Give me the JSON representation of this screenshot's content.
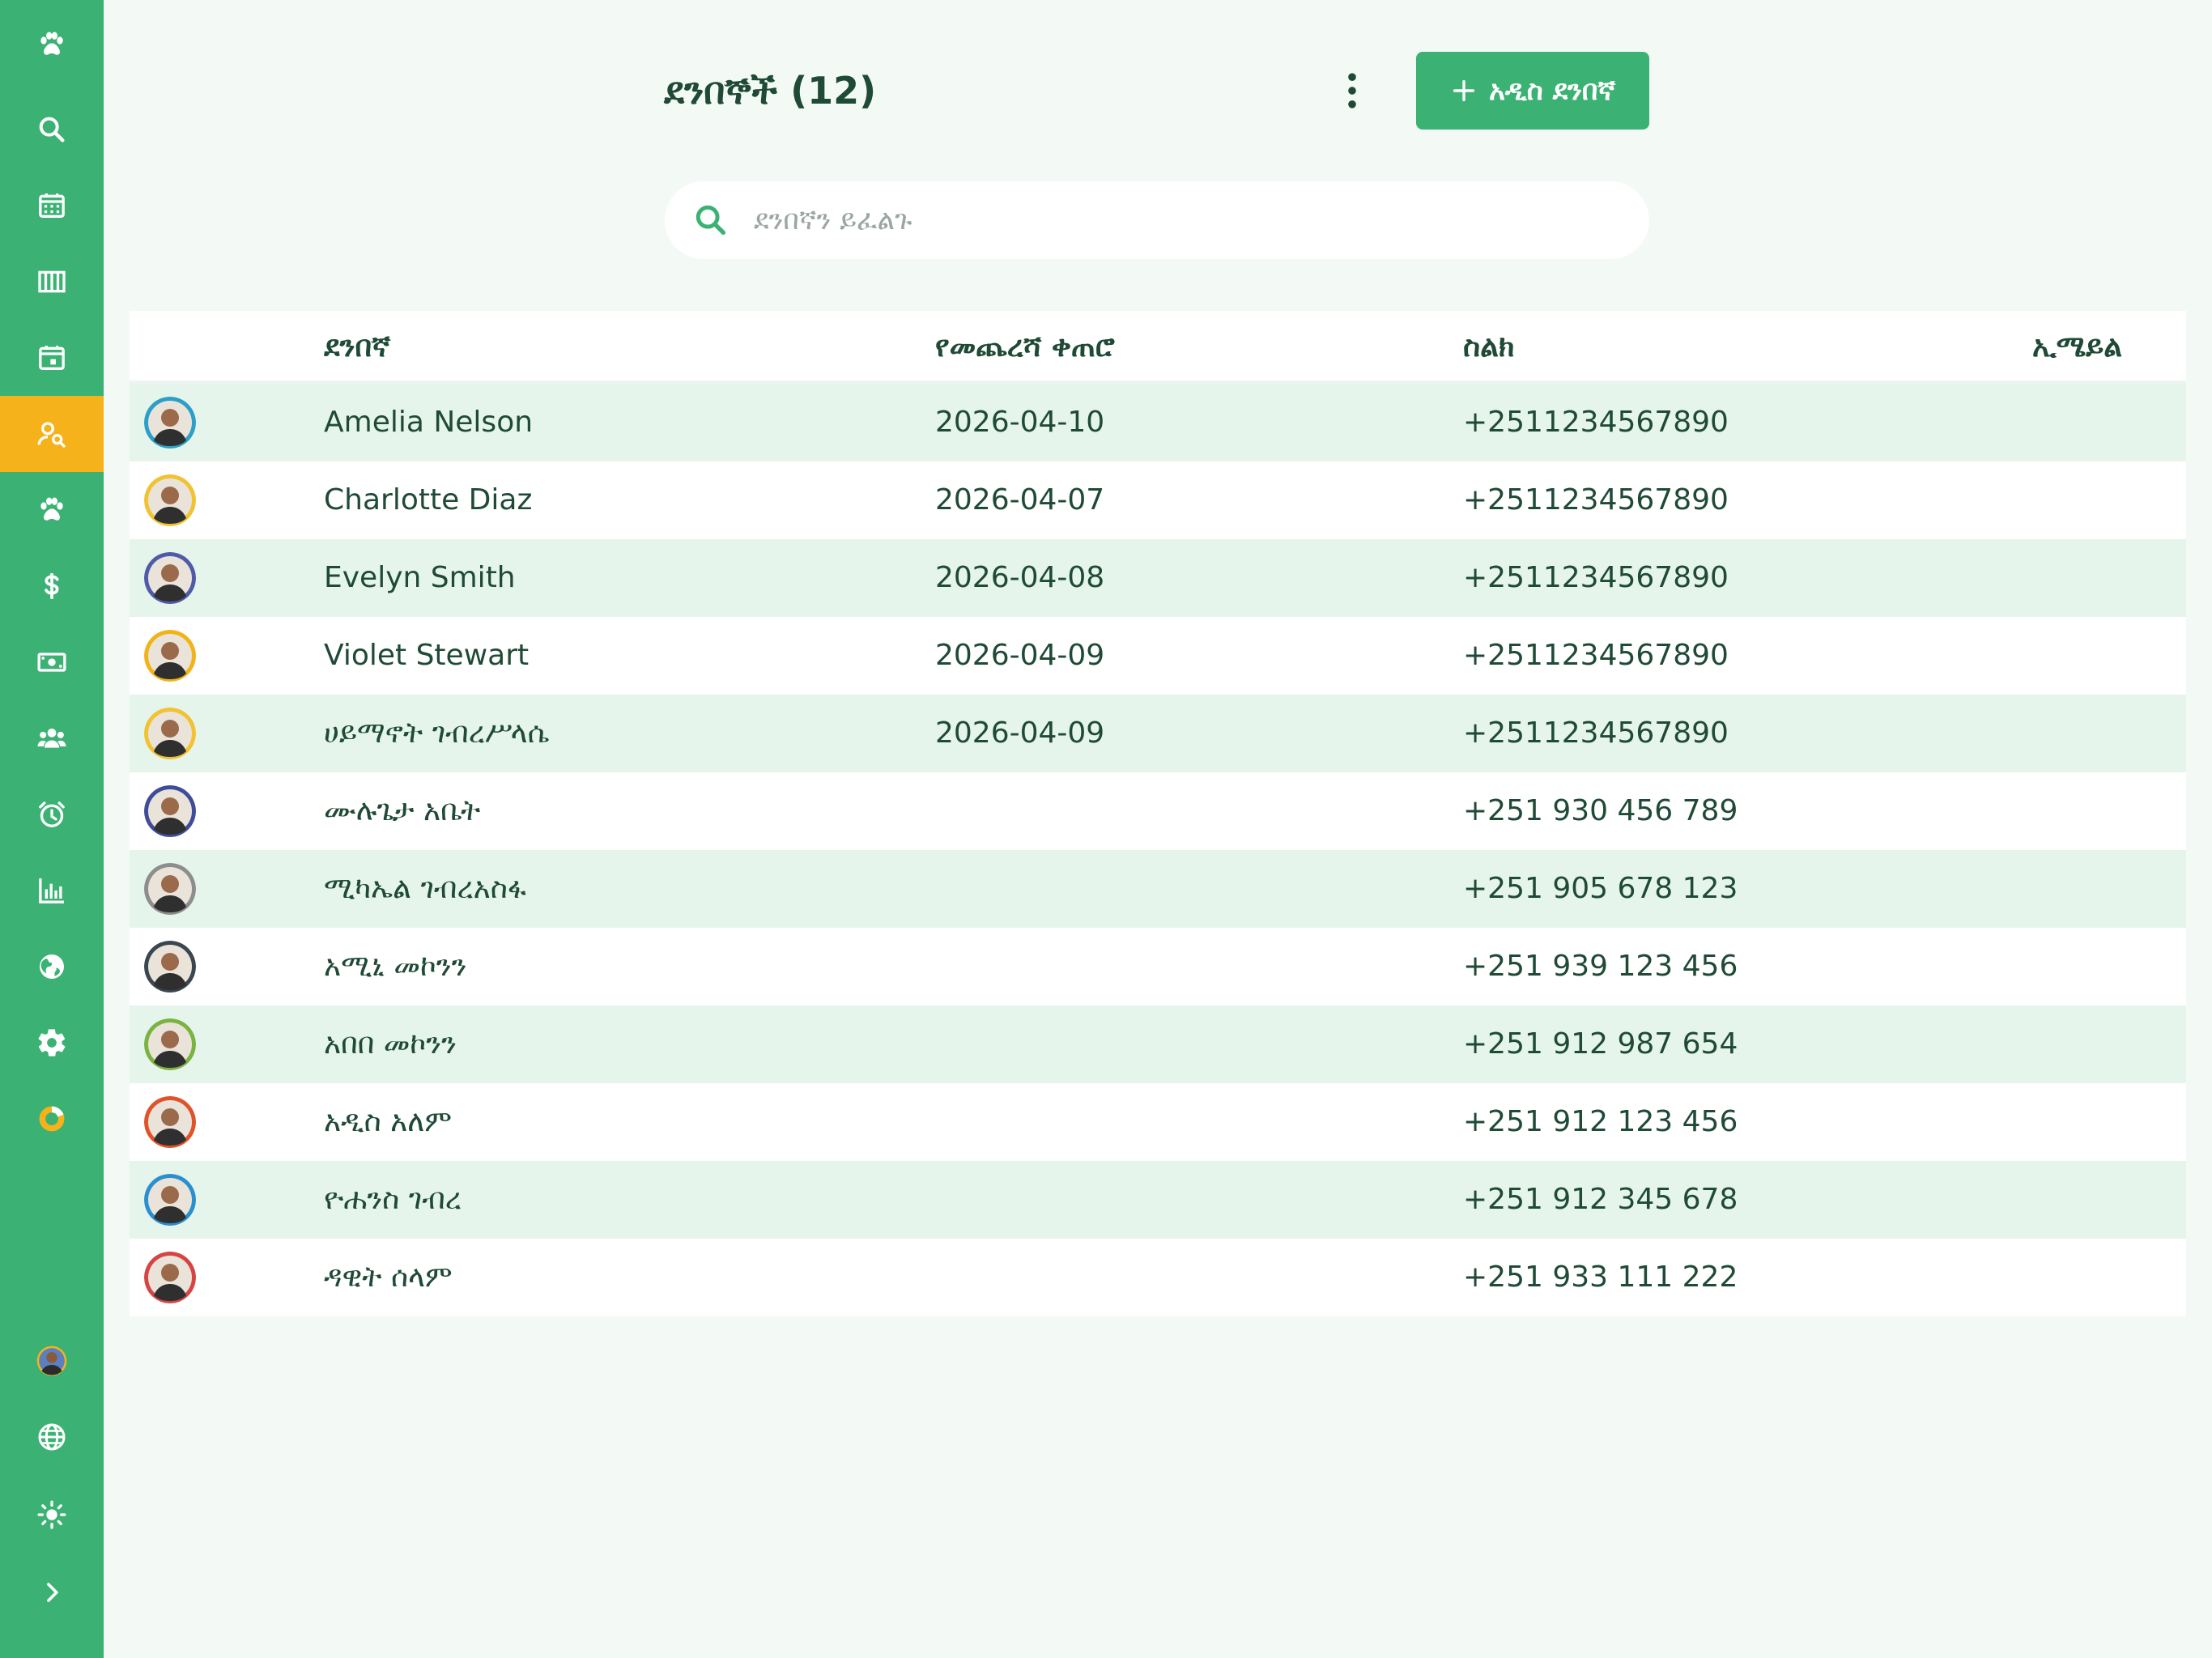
{
  "page": {
    "title": "ደንበኞች (12)",
    "add_button": "አዲስ ደንበኛ",
    "search_placeholder": "ደንበኛን ይፈልጉ"
  },
  "table": {
    "headers": [
      "ደንበኛ",
      "የመጨረሻ ቀጠሮ",
      "ስልክ",
      "ኢሜይል"
    ],
    "rows": [
      {
        "name": "Amelia Nelson",
        "last": "2026-04-10",
        "phone": "+2511234567890",
        "email": "",
        "ring": "#2aa0c8"
      },
      {
        "name": "Charlotte Diaz",
        "last": "2026-04-07",
        "phone": "+2511234567890",
        "email": "",
        "ring": "#f1c232"
      },
      {
        "name": "Evelyn Smith",
        "last": "2026-04-08",
        "phone": "+2511234567890",
        "email": "",
        "ring": "#4f5aa8"
      },
      {
        "name": "Violet Stewart",
        "last": "2026-04-09",
        "phone": "+2511234567890",
        "email": "",
        "ring": "#f1b318"
      },
      {
        "name": "ሀይማኖት ገብረሥላሴ",
        "last": "2026-04-09",
        "phone": "+2511234567890",
        "email": "",
        "ring": "#f1c232"
      },
      {
        "name": "ሙሉጌታ አቤት",
        "last": "",
        "phone": "+251 930 456 789",
        "email": "",
        "ring": "#3f4c9a"
      },
      {
        "name": "ሚካኤል ገብረአስፋ",
        "last": "",
        "phone": "+251 905 678 123",
        "email": "",
        "ring": "#8d8d8d"
      },
      {
        "name": "አሚኒ መኮንን",
        "last": "",
        "phone": "+251 939 123 456",
        "email": "",
        "ring": "#3a4750"
      },
      {
        "name": "አበበ መኮንን",
        "last": "",
        "phone": "+251 912 987 654",
        "email": "",
        "ring": "#7bb342"
      },
      {
        "name": "አዲስ አለም",
        "last": "",
        "phone": "+251 912 123 456",
        "email": "",
        "ring": "#e0532a"
      },
      {
        "name": "ዮሐንስ ገብረ",
        "last": "",
        "phone": "+251 912 345 678",
        "email": "",
        "ring": "#2a8fd0"
      },
      {
        "name": "ዳዊት ሰላም",
        "last": "",
        "phone": "+251 933 111 222",
        "email": "",
        "ring": "#d64545"
      }
    ]
  },
  "sidebar": {
    "items": [
      "paw-icon",
      "search-icon",
      "calendar-grid-icon",
      "columns-icon",
      "calendar-day-icon",
      "customers-search-icon",
      "paw-icon",
      "dollar-icon",
      "cash-icon",
      "group-icon",
      "alarm-icon",
      "bar-chart-icon",
      "globe-icon",
      "gear-icon",
      "pie-icon"
    ],
    "active": "customers-search-icon",
    "bottom": [
      "avatar",
      "language-icon",
      "sun-icon",
      "chevron-right-icon"
    ]
  },
  "colors": {
    "sidebar": "#3bb273",
    "active": "#f6b21a",
    "accent": "#3bb273",
    "text": "#1f4a36",
    "row_alt": "#e6f5ec"
  }
}
